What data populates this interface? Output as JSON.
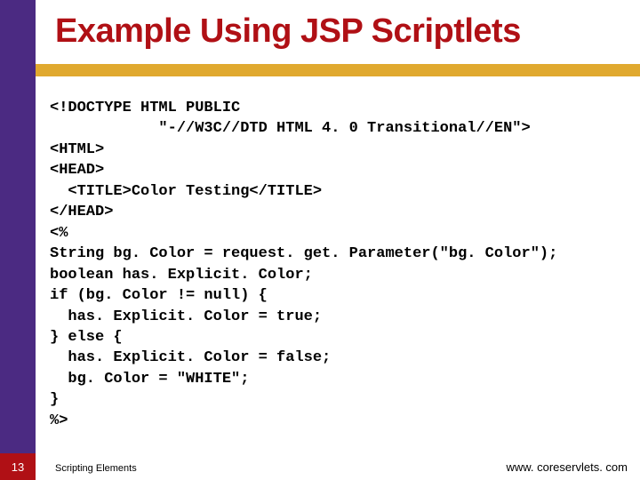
{
  "title": "Example Using JSP Scriptlets",
  "code_lines": [
    "<!DOCTYPE HTML PUBLIC",
    "            \"-//W3C//DTD HTML 4. 0 Transitional//EN\">",
    "<HTML>",
    "<HEAD>",
    "  <TITLE>Color Testing</TITLE>",
    "</HEAD>",
    "<%",
    "String bg. Color = request. get. Parameter(\"bg. Color\");",
    "boolean has. Explicit. Color;",
    "if (bg. Color != null) {",
    "  has. Explicit. Color = true;",
    "} else {",
    "  has. Explicit. Color = false;",
    "  bg. Color = \"WHITE\";",
    "}",
    "%>"
  ],
  "footer": {
    "page_number": "13",
    "left_text": "Scripting Elements",
    "right_text": "www. coreservlets. com"
  }
}
